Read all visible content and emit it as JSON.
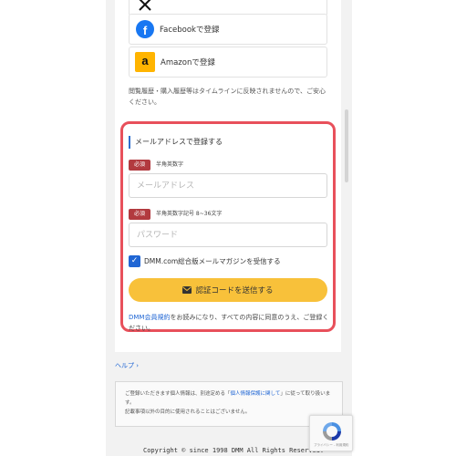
{
  "social": {
    "facebook_label": "Facebookで登録",
    "amazon_label": "Amazonで登録",
    "facebook_glyph": "f",
    "amazon_glyph": "a"
  },
  "note": "閲覧履歴・購入履歴等はタイムラインに反映されませんので、ご安心ください。",
  "register": {
    "section_title": "メールアドレスで登録する",
    "required_badge": "必須",
    "email_hint": "半角英数字",
    "email_placeholder": "メールアドレス",
    "password_hint": "半角英数字記号 8~36文字",
    "password_placeholder": "パスワード",
    "newsletter_label": "DMM.com総合版メールマガジンを受信する",
    "newsletter_checked": true,
    "submit_label": "認証コードを送信する",
    "terms_link": "DMM会員規約",
    "terms_text": "をお読みになり、すべての内容に同意のうえ、ご登録ください。"
  },
  "help": {
    "label": "ヘルプ",
    "chevron": "›"
  },
  "privacy": {
    "text_before": "ご登録いただきます個人情報は、別途定める「",
    "link": "個人情報保護に関して",
    "text_after": "」に従って取り扱います。",
    "line2": "記載事項以外の目的に使用されることはございません。"
  },
  "footer": {
    "copyright": "Copyright © since 1998 DMM All Rights Reserved."
  },
  "recaptcha": {
    "label": "プライバシー - 利用規約"
  },
  "colors": {
    "highlight_border": "#e8505b",
    "accent_blue": "#2066d4",
    "submit_yellow": "#f8c13a",
    "required_red": "#b23a3f"
  }
}
